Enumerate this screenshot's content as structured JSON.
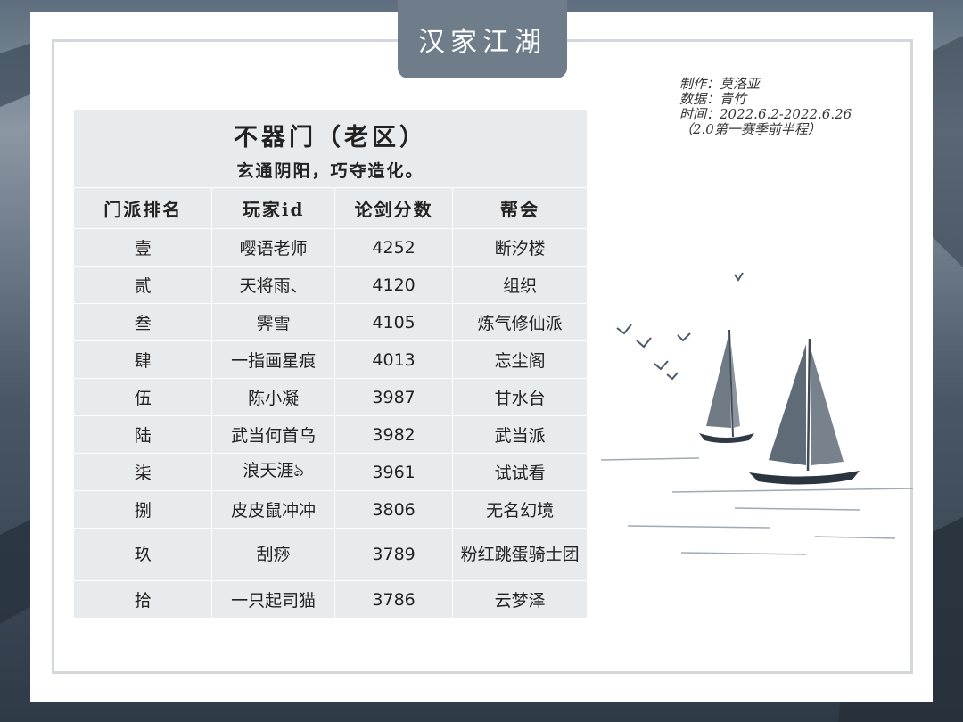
{
  "banner": "汉家江湖",
  "meta": {
    "author": "制作：莫洛亚",
    "data_source": "数据：青竹",
    "time": "时间：2022.6.2-2022.6.26",
    "note": "（2.0第一赛季前半程）"
  },
  "table": {
    "title": "不器门（老区）",
    "subtitle": "玄通阴阳，巧夺造化。",
    "headers": [
      "门派排名",
      "玩家id",
      "论剑分数",
      "帮会"
    ],
    "rows": [
      {
        "rank": "壹",
        "player": "嘤语老师",
        "score": "4252",
        "guild": "断汐楼"
      },
      {
        "rank": "贰",
        "player": "天将雨、",
        "score": "4120",
        "guild": "组织"
      },
      {
        "rank": "叁",
        "player": "霁雪",
        "score": "4105",
        "guild": "炼气修仙派"
      },
      {
        "rank": "肆",
        "player": "一指画星痕",
        "score": "4013",
        "guild": "忘尘阁"
      },
      {
        "rank": "伍",
        "player": "陈小凝",
        "score": "3987",
        "guild": "甘水台"
      },
      {
        "rank": "陆",
        "player": "武当何首乌",
        "score": "3982",
        "guild": "武当派"
      },
      {
        "rank": "柒",
        "player": "浪天涯ঌ",
        "score": "3961",
        "guild": "试试看"
      },
      {
        "rank": "捌",
        "player": "皮皮鼠冲冲",
        "score": "3806",
        "guild": "无名幻境"
      },
      {
        "rank": "玖",
        "player": "刮痧",
        "score": "3789",
        "guild": "粉红跳蛋骑士团"
      },
      {
        "rank": "拾",
        "player": "一只起司猫",
        "score": "3786",
        "guild": "云梦泽"
      }
    ]
  },
  "colors": {
    "banner": "#6f7d8b",
    "table_bg": "#e8ebee",
    "frame": "#d4d8dc"
  }
}
